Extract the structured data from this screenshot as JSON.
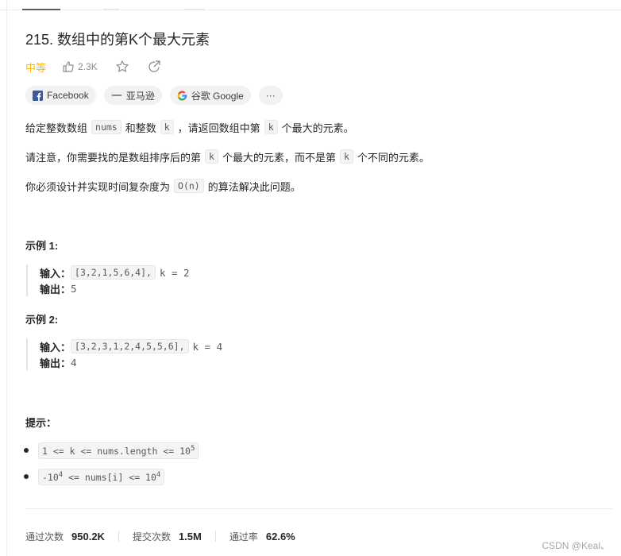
{
  "problem": {
    "title": "215. 数组中的第K个最大元素",
    "difficulty": "中等",
    "likes": "2.3K"
  },
  "tags": [
    "Facebook",
    "亚马逊",
    "谷歌 Google",
    "···"
  ],
  "description": {
    "p1": {
      "a": "给定整数数组",
      "b": "nums",
      "c": "和整数",
      "d": "k",
      "e": "，请返回数组中第",
      "f": "k",
      "g": "个最大的元素。"
    },
    "p2": {
      "a": "请注意，你需要找的是数组排序后的第",
      "b": "k",
      "c": "个最大的元素，而不是第",
      "d": "k",
      "e": "个不同的元素。"
    },
    "p3": {
      "a": "你必须设计并实现时间复杂度为",
      "b": "O(n)",
      "c": "的算法解决此问题。"
    }
  },
  "examples": [
    {
      "title": "示例 1:",
      "input_label": "输入：",
      "input_code": "[3,2,1,5,6,4],",
      "input_rest": "k = 2",
      "output_label": "输出：",
      "output": "5"
    },
    {
      "title": "示例 2:",
      "input_label": "输入：",
      "input_code": "[3,2,3,1,2,4,5,5,6],",
      "input_rest": "k = 4",
      "output_label": "输出：",
      "output": "4"
    }
  ],
  "hints": {
    "title": "提示：",
    "h1": {
      "a": "1 <= k <= nums.length <= 10",
      "sup": "5"
    },
    "h2": {
      "a": "-10",
      "sup1": "4",
      "b": " <= nums[i] <= 10",
      "sup2": "4"
    }
  },
  "stats": [
    {
      "label": "通过次数",
      "value": "950.2K"
    },
    {
      "label": "提交次数",
      "value": "1.5M"
    },
    {
      "label": "通过率",
      "value": "62.6%"
    }
  ],
  "watermark": "CSDN @Keal、",
  "colors": {
    "difficulty": "#ffb800",
    "facebook": "#3b5998",
    "text": "#262626"
  }
}
